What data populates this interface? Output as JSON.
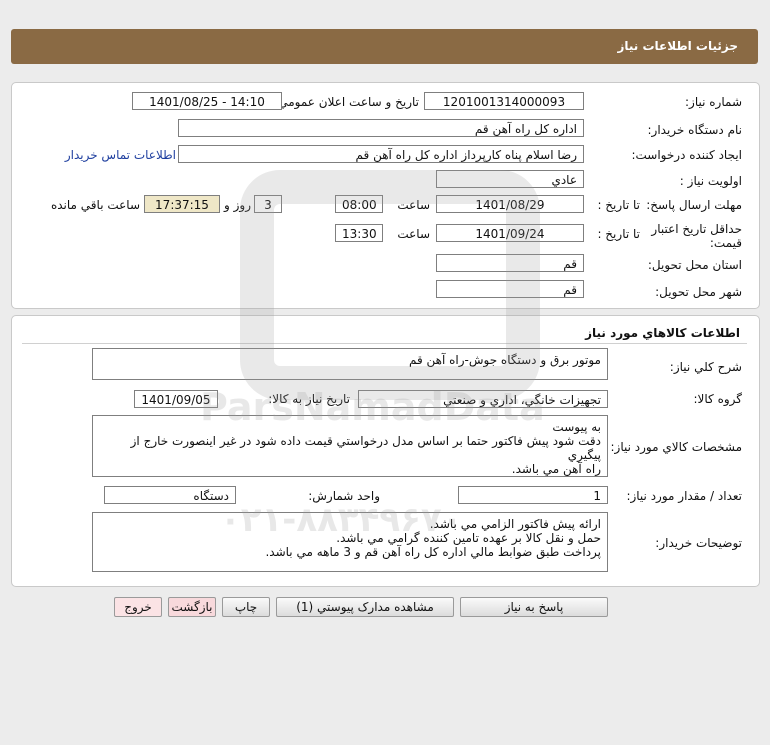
{
  "header": {
    "title": "جزئيات اطلاعات نياز"
  },
  "info": {
    "need_number_label": "شماره نياز:",
    "need_number": "1201001314000093",
    "announce_label": "تاريخ و ساعت اعلان عمومي:",
    "announce_value": "1401/08/25 - 14:10",
    "buyer_label": "نام دستگاه خريدار:",
    "buyer_value": "اداره کل  راه آهن قم",
    "creator_label": "ايجاد کننده درخواست:",
    "creator_value": "رضا اسلام پناه کارپرداز اداره کل  راه آهن قم",
    "contact_link": "اطلاعات تماس خريدار",
    "priority_label": "اولويت نياز :",
    "priority_value": "عادي",
    "deadline_label": "مهلت ارسال پاسخ:",
    "to_date_label": "تا تاريخ :",
    "deadline_date": "1401/08/29",
    "time_label": "ساعت",
    "deadline_time": "08:00",
    "days_value": "3",
    "days_label": "روز و",
    "remaining_time": "17:37:15",
    "remaining_label": "ساعت باقي مانده",
    "validity_label": "حداقل تاريخ اعتبار قيمت:",
    "validity_date": "1401/09/24",
    "validity_time": "13:30",
    "province_label": "استان محل تحويل:",
    "province_value": "قم",
    "city_label": "شهر محل تحويل:",
    "city_value": "قم"
  },
  "goods": {
    "section_title": "اطلاعات کالاهاي مورد نياز",
    "desc_label": "شرح کلي نياز:",
    "desc_value": "موتور برق و دستگاه جوش-راه آهن قم",
    "group_label": "گروه کالا:",
    "group_value": "تجهيزات خانگي، اداري و صنعتي",
    "need_date_label": "تاريخ نياز به کالا:",
    "need_date_value": "1401/09/05",
    "specs_label": "مشخصات کالاي مورد نياز:",
    "specs_lines": [
      "به پيوست",
      "دقت شود پيش فاکتور حتما بر اساس مدل درخواستي قيمت داده شود در غير اينصورت خارج از پيگيري",
      "راه آهن مي باشد."
    ],
    "qty_label": "تعداد / مقدار مورد نياز:",
    "qty_value": "1",
    "unit_label": "واحد شمارش:",
    "unit_value": "دستگاه",
    "buyer_notes_label": "توضيحات خريدار:",
    "buyer_notes_lines": [
      "ارائه پيش فاکتور الزامي مي باشد.",
      "حمل و نقل کالا بر عهده تامين کننده گرامي مي باشد.",
      "پرداخت طبق ضوابط مالي اداره کل راه آهن قم و 3 ماهه مي باشد."
    ]
  },
  "buttons": {
    "reply": "پاسخ به نياز",
    "attachments": "مشاهده مدارک پيوستي (1)",
    "print": "چاپ",
    "back": "بازگشت",
    "exit": "خروج"
  },
  "watermark": {
    "brand": "ParsNamadData",
    "phone": "۰۲۱-۸۸۳۴۹۶۷۰"
  }
}
